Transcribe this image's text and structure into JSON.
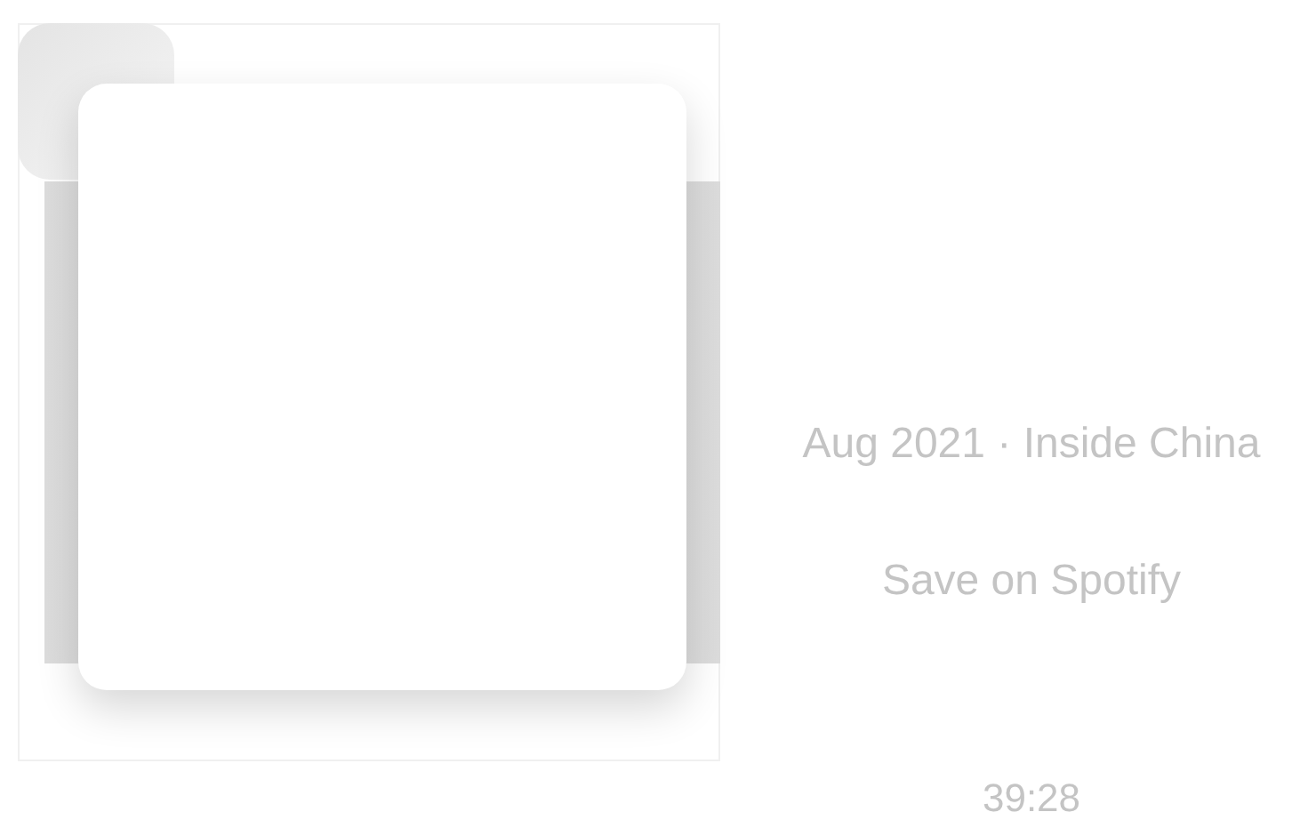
{
  "episode": {
    "meta": "Aug 2021 · Inside China",
    "save_link": "Save on Spotify",
    "duration": "39:28"
  }
}
